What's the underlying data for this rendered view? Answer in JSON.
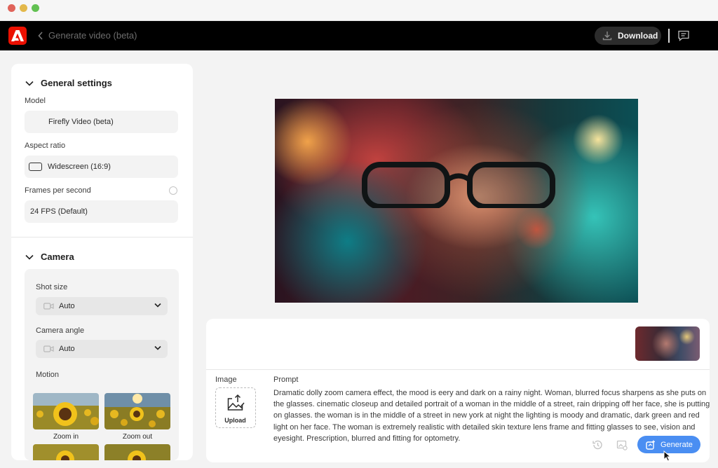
{
  "app": {
    "title": "Generate video (beta)",
    "download_label": "Download"
  },
  "settings": {
    "general_title": "General settings",
    "model_label": "Model",
    "model_value": "Firefly Video (beta)",
    "aspect_label": "Aspect ratio",
    "aspect_value": "Widescreen (16:9)",
    "fps_label": "Frames per second",
    "fps_value": "24 FPS (Default)"
  },
  "camera": {
    "title": "Camera",
    "shot_label": "Shot size",
    "shot_value": "Auto",
    "angle_label": "Camera angle",
    "angle_value": "Auto",
    "motion_label": "Motion",
    "motion_options": [
      "Zoom in",
      "Zoom out"
    ]
  },
  "prompt": {
    "image_label": "Image",
    "upload_label": "Upload",
    "prompt_label": "Prompt",
    "prompt_text": "Dramatic dolly zoom camera effect, the mood is eery and dark on a rainy night. Woman, blurred focus sharpens as she puts on the glasses. cinematic closeup and detailed portrait of a woman in the middle of a street, rain dripping off her face, she is putting on glasses. the woman is in the middle of a street in new york at night the lighting is moody and dramatic, dark green and red light on her face. The woman is extremely realistic with detailed skin texture lens frame and fitting glasses to see, vision and eyesight. Prescription, blurred and fitting for optometry.",
    "generate_label": "Generate"
  },
  "colors": {
    "brand": "#eb1000",
    "accent": "#4a8ef2"
  }
}
